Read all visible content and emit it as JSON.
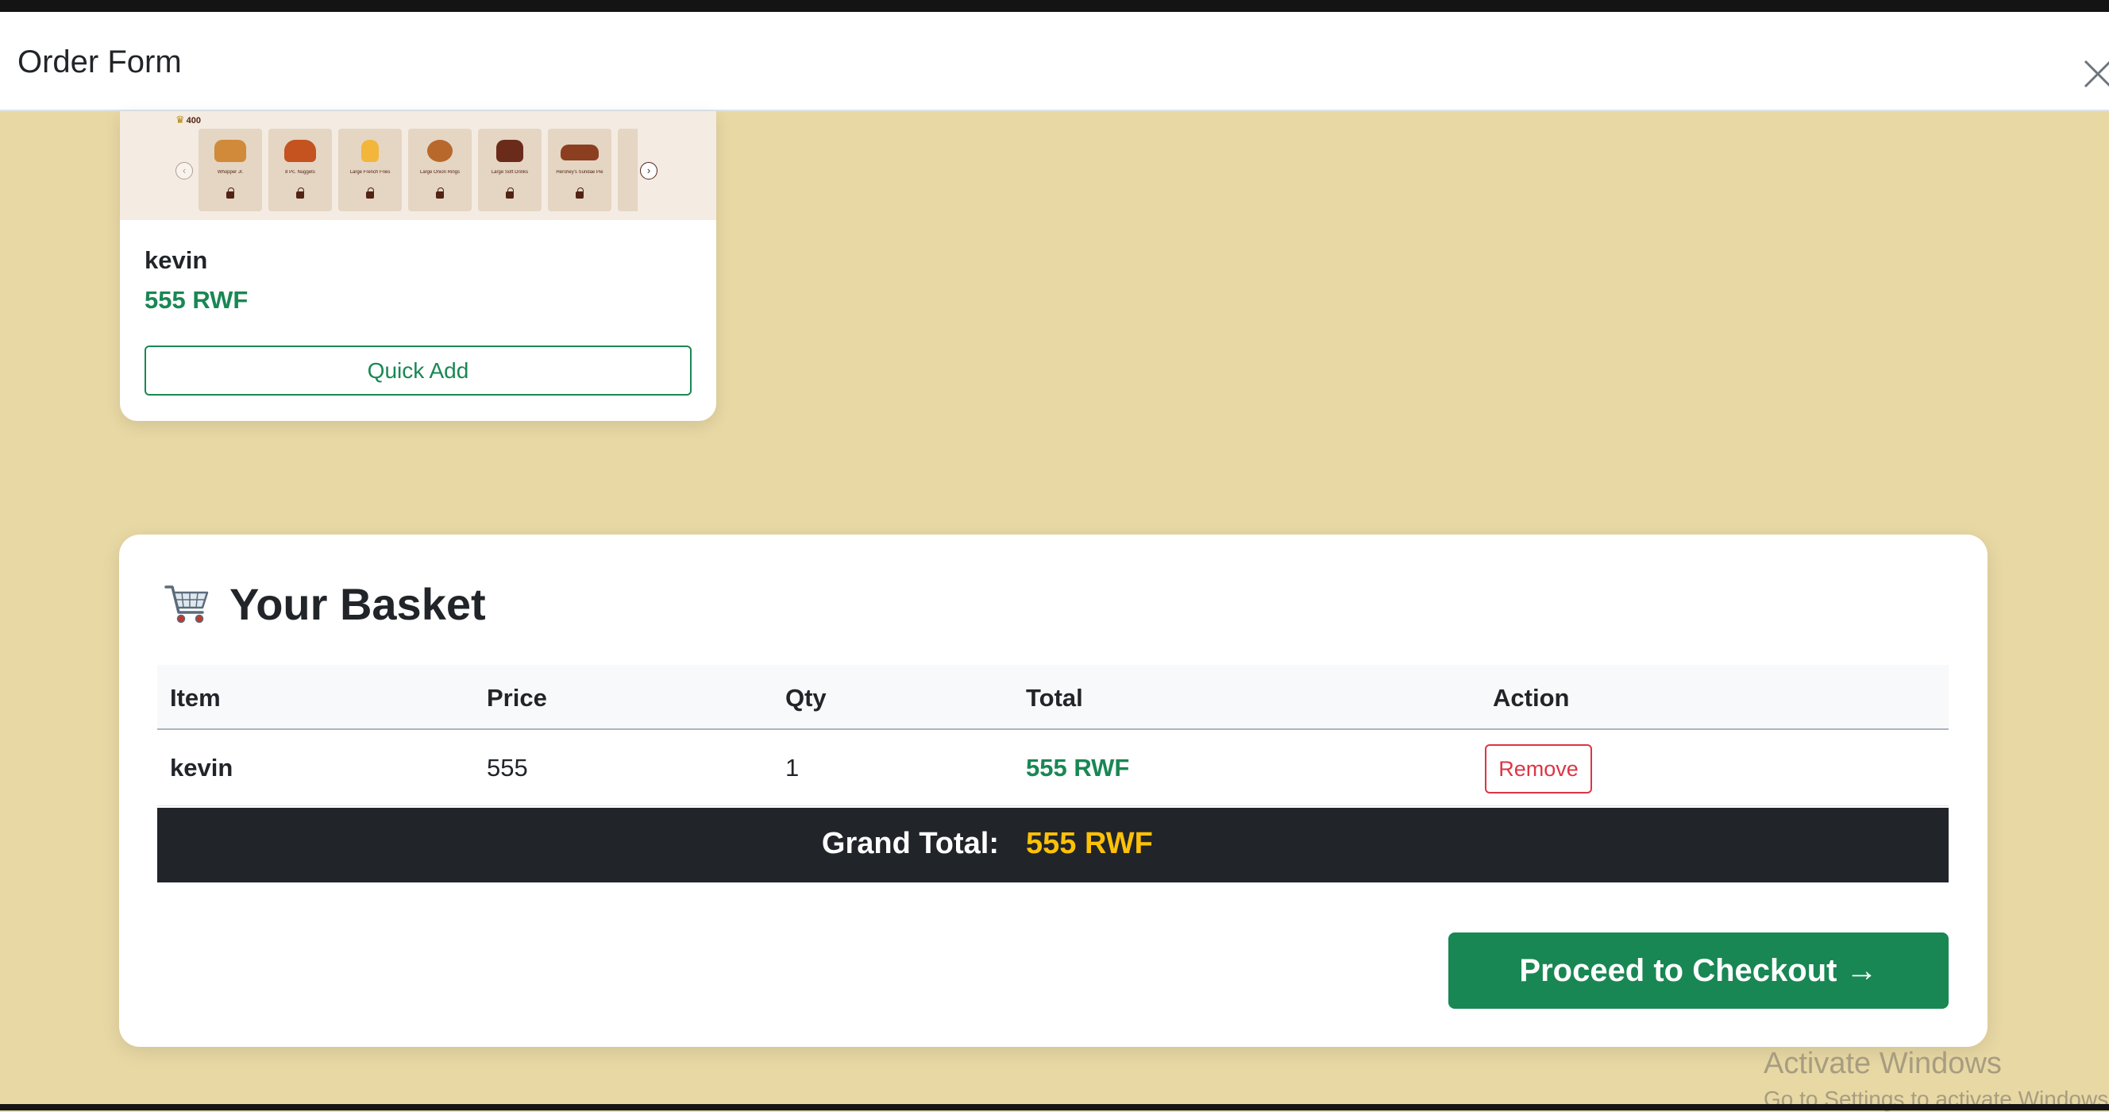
{
  "modal": {
    "title": "Order Form"
  },
  "product": {
    "promo": {
      "points": "400",
      "items": [
        {
          "label": "Whopper Jr."
        },
        {
          "label": "8 Pc. Nuggets"
        },
        {
          "label": "Large French Fries"
        },
        {
          "label": "Large Onion Rings"
        },
        {
          "label": "Large Soft Drinks"
        },
        {
          "label": "Hershey's Sundae Pie"
        }
      ]
    },
    "name": "kevin",
    "price": "555 RWF",
    "quick_add_label": "Quick Add"
  },
  "basket": {
    "title": "Your Basket",
    "columns": {
      "item": "Item",
      "price": "Price",
      "qty": "Qty",
      "total": "Total",
      "action": "Action"
    },
    "rows": [
      {
        "item": "kevin",
        "price": "555",
        "qty": "1",
        "total": "555 RWF",
        "action": "Remove"
      }
    ],
    "grand_total_label": "Grand Total:",
    "grand_total_value": "555 RWF",
    "checkout_label": "Proceed to Checkout →"
  },
  "watermark": {
    "title": "Activate Windows",
    "subtitle": "Go to Settings to activate Windows."
  },
  "colors": {
    "page_bg": "#e8d8a4",
    "success": "#198754",
    "danger": "#dc3545",
    "dark": "#212529",
    "warning": "#ffc107"
  }
}
